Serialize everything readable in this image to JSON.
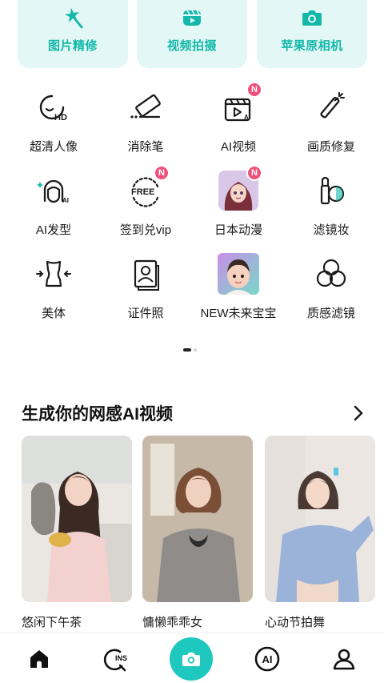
{
  "top_cards": [
    {
      "label": "图片精修",
      "icon": "magic-star-icon"
    },
    {
      "label": "视频拍摄",
      "icon": "video-clapper-icon"
    },
    {
      "label": "苹果原相机",
      "icon": "camera-icon"
    }
  ],
  "grid": [
    {
      "label": "超清人像",
      "icon": "hd-face-icon",
      "badge": ""
    },
    {
      "label": "消除笔",
      "icon": "eraser-icon",
      "badge": ""
    },
    {
      "label": "AI视频",
      "icon": "ai-video-icon",
      "badge": "N"
    },
    {
      "label": "画质修复",
      "icon": "magic-wand-icon",
      "badge": ""
    },
    {
      "label": "AI发型",
      "icon": "ai-hairstyle-icon",
      "badge": ""
    },
    {
      "label": "签到兑vip",
      "icon": "free-checkin-icon",
      "badge": "N"
    },
    {
      "label": "日本动漫",
      "icon": "anime-thumbnail",
      "badge": "N"
    },
    {
      "label": "滤镜妆",
      "icon": "makeup-filter-icon",
      "badge": ""
    },
    {
      "label": "美体",
      "icon": "body-shape-icon",
      "badge": ""
    },
    {
      "label": "证件照",
      "icon": "id-photo-icon",
      "badge": ""
    },
    {
      "label": "NEW未来宝宝",
      "icon": "future-baby-thumbnail",
      "badge": ""
    },
    {
      "label": "质感滤镜",
      "icon": "texture-filter-icon",
      "badge": ""
    }
  ],
  "section": {
    "title": "生成你的网感AI视频",
    "arrow": "chevron-right-icon"
  },
  "videos": [
    {
      "caption": "悠闲下午茶"
    },
    {
      "caption": "慵懒乖乖女"
    },
    {
      "caption": "心动节拍舞"
    }
  ],
  "nav": [
    {
      "name": "home",
      "icon": "home-icon"
    },
    {
      "name": "ins",
      "icon": "ins-search-icon",
      "text": "INS"
    },
    {
      "name": "camera",
      "icon": "camera-icon"
    },
    {
      "name": "ai",
      "icon": "ai-icon",
      "text": "AI"
    },
    {
      "name": "profile",
      "icon": "person-icon"
    }
  ],
  "colors": {
    "accent": "#1ec8be",
    "accent_text": "#14b8aa",
    "card_bg": "#e3f8f6",
    "badge": "#f0507a"
  }
}
